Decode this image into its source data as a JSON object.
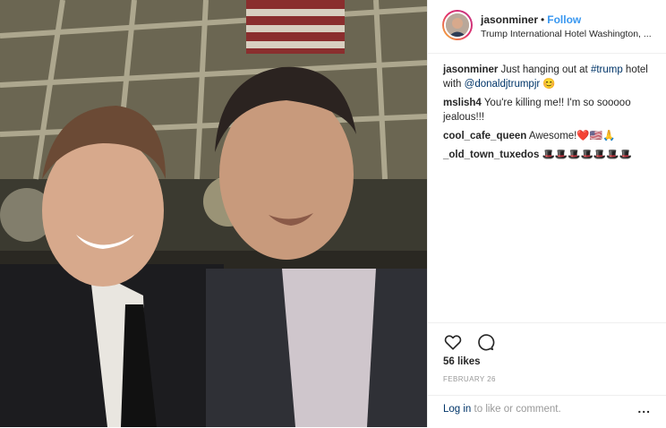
{
  "post": {
    "username": "jasonminer",
    "separator": "•",
    "follow_label": "Follow",
    "location": "Trump International Hotel Washington, ..."
  },
  "comments": [
    {
      "user": "jasonminer",
      "parts": [
        {
          "text": " Just hanging out at ",
          "link": false
        },
        {
          "text": "#trump",
          "link": true
        },
        {
          "text": " hotel with ",
          "link": false
        },
        {
          "text": "@donaldjtrumpjr",
          "link": true
        },
        {
          "text": " 😊",
          "link": false
        }
      ]
    },
    {
      "user": "mslish4",
      "parts": [
        {
          "text": " You're killing me!! I'm so sooooo jealous!!!",
          "link": false
        }
      ]
    },
    {
      "user": "cool_cafe_queen",
      "parts": [
        {
          "text": " Awesome!❤️🇺🇸🙏",
          "link": false
        }
      ]
    },
    {
      "user": "_old_town_tuxedos",
      "parts": [
        {
          "text": " 🎩🎩🎩🎩🎩🎩🎩",
          "link": false
        }
      ]
    }
  ],
  "actions": {
    "like_icon": "heart-icon",
    "comment_icon": "comment-icon",
    "likes": "56 likes",
    "date": "FEBRUARY 26"
  },
  "footer": {
    "login_link": "Log in",
    "login_rest": " to like or comment.",
    "more": "..."
  },
  "colors": {
    "follow": "#3897f0",
    "link": "#003569",
    "muted": "#999999",
    "border": "#efefef"
  }
}
